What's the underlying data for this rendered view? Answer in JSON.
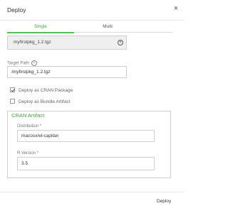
{
  "dialog": {
    "title": "Deploy",
    "close_glyph": "×",
    "tabs": [
      {
        "label": "Single",
        "active": true
      },
      {
        "label": "Multi",
        "active": false
      }
    ],
    "file": {
      "name": "myfirstpkg_1.2.tgz",
      "clear_glyph": "×"
    },
    "target_path": {
      "label": "Target Path",
      "help_glyph": "?",
      "value": "/myfirstpkg_1.2.tgz"
    },
    "options": [
      {
        "label": "Deploy as CRAN Package",
        "checked": true
      },
      {
        "label": "Deploy as Bundle Artifact",
        "checked": false
      }
    ],
    "cran_artifact": {
      "title": "CRAN Artifact",
      "distribution": {
        "label": "Distribution *",
        "value": "macosx/el-capitan"
      },
      "r_version": {
        "label": "R Version *",
        "value": "3.5"
      }
    },
    "footer": {
      "deploy_label": "Deploy"
    },
    "colors": {
      "accent": "#5cb85c",
      "border": "#cfcfcf"
    }
  }
}
